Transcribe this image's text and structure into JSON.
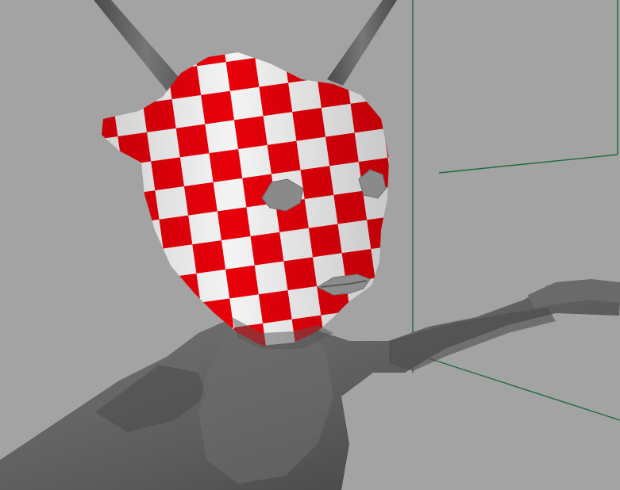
{
  "viewport": {
    "background_color": "#a3a3a3",
    "grid_line_color": "#1f6b3f",
    "mesh_gray": "#5c5c5c",
    "mesh_gray_light": "#7a7a7a",
    "mesh_gray_dark": "#3d3d3d",
    "checker_red": "#e8000a",
    "checker_white": "#f4f4f4"
  }
}
